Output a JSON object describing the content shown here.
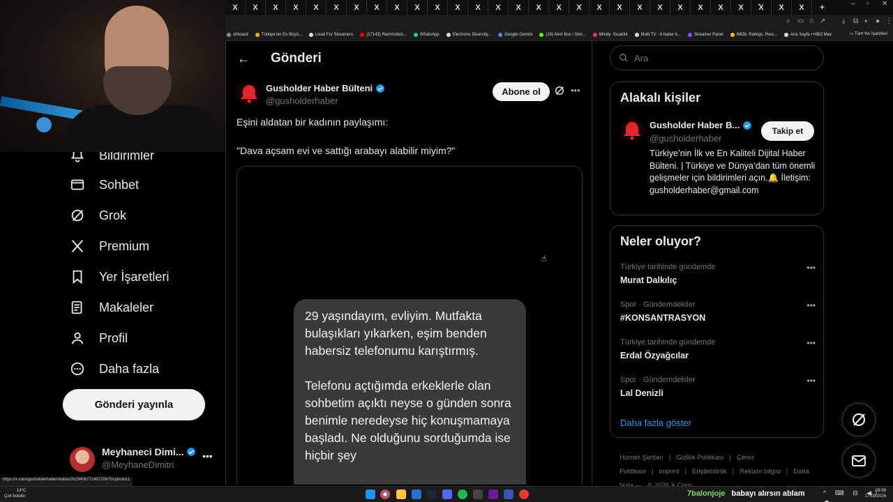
{
  "browser": {
    "tab_glyph": "X",
    "new_tab": "+",
    "window_controls": [
      "–",
      "▫",
      "✕"
    ],
    "bookmarks": [
      {
        "label": "shboard",
        "color": "#888888"
      },
      {
        "label": "Türkiye'nin En Büyü...",
        "color": "#f5b400"
      },
      {
        "label": "Livad For Streamers",
        "color": "#dddddd"
      },
      {
        "label": "(17145) Rammstein...",
        "color": "#ff0000"
      },
      {
        "label": "WhatsApp",
        "color": "#25d366"
      },
      {
        "label": "Electronic Diversity...",
        "color": "#dddddd"
      },
      {
        "label": "Google Gemini",
        "color": "#4a8af4"
      },
      {
        "label": "(19) Alert Box / Stre...",
        "color": "#53fc18"
      },
      {
        "label": "Windy: Sıcaklık",
        "color": "#e53935"
      },
      {
        "label": "Multi TV - 6 haber k...",
        "color": "#dddddd"
      },
      {
        "label": "Streamer Panel",
        "color": "#9146ff"
      },
      {
        "label": "IMDb: Ratings, Revi...",
        "color": "#f5c518"
      },
      {
        "label": "Ana Sayfa • HBO Max",
        "color": "#dddddd"
      }
    ],
    "bookmarks_overflow": "»",
    "all_bookmarks": "Tüm Yer İşaretleri"
  },
  "nav": {
    "items": [
      {
        "label": "Bildirimler",
        "icon": "bell-icon"
      },
      {
        "label": "Sohbet",
        "icon": "mail-icon"
      },
      {
        "label": "Grok",
        "icon": "grok-icon"
      },
      {
        "label": "Premium",
        "icon": "x-logo-icon"
      },
      {
        "label": "Yer İşaretleri",
        "icon": "bookmark-icon"
      },
      {
        "label": "Makaleler",
        "icon": "article-icon"
      },
      {
        "label": "Profil",
        "icon": "person-icon"
      },
      {
        "label": "Daha fazla",
        "icon": "more-circle-icon"
      }
    ],
    "post_button": "Gönderi yayınla",
    "account": {
      "name": "Meyhaneci Dimi...",
      "handle": "@MeyhaneDimitri",
      "more": "•••"
    }
  },
  "main": {
    "title": "Gönderi",
    "back": "←",
    "post": {
      "author_name": "Gusholder Haber Bülteni",
      "author_handle": "@gusholderhaber",
      "subscribe": "Abone ol",
      "more": "•••",
      "text_line1": "Eşini aldatan bir kadının paylaşımı:",
      "text_line2": "\"Dava açsam evi ve sattığı arabayı alabilir miyim?\"",
      "image_paragraph1": "29 yaşındayım, evliyim. Mutfakta bulaşıkları yıkarken, eşim benden habersiz telefonumu karıştırmış.",
      "image_paragraph2": "Telefonu açtığımda erkeklerle olan sohbetim açıktı neyse o günden sonra benimle neredeyse hiç konuşmamaya başladı. Ne olduğunu sorduğumda ise hiçbir şey"
    }
  },
  "right": {
    "search_placeholder": "Ara",
    "related": {
      "title": "Alakalı kişiler",
      "name": "Gusholder Haber B...",
      "handle": "@gusholderhaber",
      "follow": "Takip et",
      "bio": "Türkiye’nin İlk ve En Kaliteli Dijital Haber Bülteni. | Türkiye ve Dünya’dan tüm önemli gelişmeler için bildirimleri açın.🔔 İletişim: gusholderhaber@gmail.com"
    },
    "trends": {
      "title": "Neler oluyor?",
      "items": [
        {
          "meta": "Türkiye tarihinde gündemde",
          "name": "Murat Dalkılıç"
        },
        {
          "meta": "Spor · Gündemdekiler",
          "name": "#KONSANTRASYON"
        },
        {
          "meta": "Türkiye tarihinde gündemde",
          "name": "Erdal Özyağcılar"
        },
        {
          "meta": "Spor · Gündemdekiler",
          "name": "Lal Denizli"
        }
      ],
      "item_more": "•••",
      "show_more": "Daha fazla göster"
    },
    "footer": [
      "Hizmet Şartları",
      "|",
      "Gizlilik Politikası",
      "|",
      "Çerez Politikası",
      "|",
      "Imprint",
      "|",
      "Erişilebilirlik",
      "|",
      "Reklam bilgisi",
      "|",
      "Daha fazla ···",
      "© 2026 X Corp."
    ]
  },
  "status_url": "https://x.com/gusholderhaber/status/2023408772497256701/photo/1",
  "taskbar": {
    "weather_temp": "14°C",
    "weather_desc": "Çok bulutlu",
    "ticker_user": "7balonjoje",
    "ticker_msg": "babayı alırsın ablam",
    "time": "08:56",
    "date": "17.02.2026",
    "tray": "^ ⌨ ⊟ ◀) ☁"
  },
  "colors": {
    "accent": "#1d9bf0",
    "verified": "#1d9bf0",
    "bg": "#000000"
  }
}
